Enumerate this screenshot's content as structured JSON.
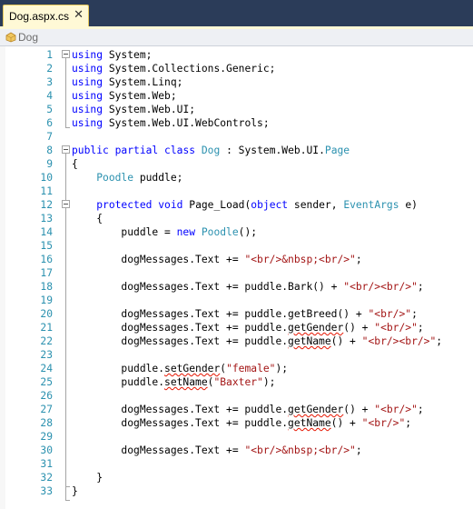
{
  "tab": {
    "title": "Dog.aspx.cs",
    "close_glyph": "✕"
  },
  "navbar": {
    "class_name": "Dog"
  },
  "colors": {
    "keyword": "#0000ff",
    "type": "#2b91af",
    "string": "#a31515",
    "line_number": "#2b91af",
    "squiggle": "#e51400"
  },
  "code": {
    "lines": [
      {
        "n": "1",
        "tokens": [
          [
            "kw",
            "using"
          ],
          [
            "",
            "System;"
          ]
        ]
      },
      {
        "n": "2",
        "tokens": [
          [
            "kw",
            "using"
          ],
          [
            "",
            "System.Collections.Generic;"
          ]
        ]
      },
      {
        "n": "3",
        "tokens": [
          [
            "kw",
            "using"
          ],
          [
            "",
            "System.Linq;"
          ]
        ]
      },
      {
        "n": "4",
        "tokens": [
          [
            "kw",
            "using"
          ],
          [
            "",
            "System.Web;"
          ]
        ]
      },
      {
        "n": "5",
        "tokens": [
          [
            "kw",
            "using"
          ],
          [
            "",
            "System.Web.UI;"
          ]
        ]
      },
      {
        "n": "6",
        "tokens": [
          [
            "kw",
            "using"
          ],
          [
            "",
            "System.Web.UI.WebControls;"
          ]
        ]
      },
      {
        "n": "7",
        "tokens": []
      },
      {
        "n": "8",
        "tokens": [
          [
            "kw",
            "public"
          ],
          [
            "",
            " "
          ],
          [
            "kw",
            "partial"
          ],
          [
            "",
            " "
          ],
          [
            "kw",
            "class"
          ],
          [
            "",
            " "
          ],
          [
            "tp",
            "Dog"
          ],
          [
            "",
            " : System.Web.UI."
          ],
          [
            "tp",
            "Page"
          ]
        ]
      },
      {
        "n": "9",
        "tokens": [
          [
            "",
            "{"
          ]
        ]
      },
      {
        "n": "10",
        "tokens": [
          [
            "",
            "    "
          ],
          [
            "tp",
            "Poodle"
          ],
          [
            "",
            " puddle;"
          ]
        ]
      },
      {
        "n": "11",
        "tokens": []
      },
      {
        "n": "12",
        "tokens": [
          [
            "",
            "    "
          ],
          [
            "kw",
            "protected"
          ],
          [
            "",
            " "
          ],
          [
            "kw",
            "void"
          ],
          [
            "",
            " Page_Load("
          ],
          [
            "kw",
            "object"
          ],
          [
            "",
            " sender, "
          ],
          [
            "tp",
            "EventArgs"
          ],
          [
            "",
            " e)"
          ]
        ]
      },
      {
        "n": "13",
        "tokens": [
          [
            "",
            "    {"
          ]
        ]
      },
      {
        "n": "14",
        "tokens": [
          [
            "",
            "        puddle = "
          ],
          [
            "kw",
            "new"
          ],
          [
            "",
            " "
          ],
          [
            "tp",
            "Poodle"
          ],
          [
            "",
            "();"
          ]
        ]
      },
      {
        "n": "15",
        "tokens": []
      },
      {
        "n": "16",
        "tokens": [
          [
            "",
            "        dogMessages.Text += "
          ],
          [
            "st",
            "\"<br/>&nbsp;<br/>\""
          ],
          [
            "",
            ";"
          ]
        ]
      },
      {
        "n": "17",
        "tokens": []
      },
      {
        "n": "18",
        "tokens": [
          [
            "",
            "        dogMessages.Text += puddle.Bark() + "
          ],
          [
            "st",
            "\"<br/><br/>\""
          ],
          [
            "",
            ";"
          ]
        ]
      },
      {
        "n": "19",
        "tokens": []
      },
      {
        "n": "20",
        "tokens": [
          [
            "",
            "        dogMessages.Text += puddle.getBreed() + "
          ],
          [
            "st",
            "\"<br/>\""
          ],
          [
            "",
            ";"
          ]
        ]
      },
      {
        "n": "21",
        "tokens": [
          [
            "",
            "        dogMessages.Text += puddle."
          ],
          [
            "sq",
            "getGender"
          ],
          [
            "",
            "() + "
          ],
          [
            "st",
            "\"<br/>\""
          ],
          [
            "",
            ";"
          ]
        ]
      },
      {
        "n": "22",
        "tokens": [
          [
            "",
            "        dogMessages.Text += puddle."
          ],
          [
            "sq",
            "getName"
          ],
          [
            "",
            "() + "
          ],
          [
            "st",
            "\"<br/><br/>\""
          ],
          [
            "",
            ";"
          ]
        ]
      },
      {
        "n": "23",
        "tokens": []
      },
      {
        "n": "24",
        "tokens": [
          [
            "",
            "        puddle."
          ],
          [
            "sq",
            "setGender"
          ],
          [
            "",
            "("
          ],
          [
            "st",
            "\"female\""
          ],
          [
            "",
            ");"
          ]
        ]
      },
      {
        "n": "25",
        "tokens": [
          [
            "",
            "        puddle."
          ],
          [
            "sq",
            "setName"
          ],
          [
            "",
            "("
          ],
          [
            "st",
            "\"Baxter\""
          ],
          [
            "",
            ");"
          ]
        ]
      },
      {
        "n": "26",
        "tokens": []
      },
      {
        "n": "27",
        "tokens": [
          [
            "",
            "        dogMessages.Text += puddle."
          ],
          [
            "sq",
            "getGender"
          ],
          [
            "",
            "() + "
          ],
          [
            "st",
            "\"<br/>\""
          ],
          [
            "",
            ";"
          ]
        ]
      },
      {
        "n": "28",
        "tokens": [
          [
            "",
            "        dogMessages.Text += puddle."
          ],
          [
            "sq",
            "getName"
          ],
          [
            "",
            "() + "
          ],
          [
            "st",
            "\"<br/>\""
          ],
          [
            "",
            ";"
          ]
        ]
      },
      {
        "n": "29",
        "tokens": []
      },
      {
        "n": "30",
        "tokens": [
          [
            "",
            "        dogMessages.Text += "
          ],
          [
            "st",
            "\"<br/>&nbsp;<br/>\""
          ],
          [
            "",
            ";"
          ]
        ]
      },
      {
        "n": "31",
        "tokens": []
      },
      {
        "n": "32",
        "tokens": [
          [
            "",
            "    }"
          ]
        ]
      },
      {
        "n": "33",
        "tokens": [
          [
            "",
            "}"
          ]
        ]
      }
    ]
  }
}
